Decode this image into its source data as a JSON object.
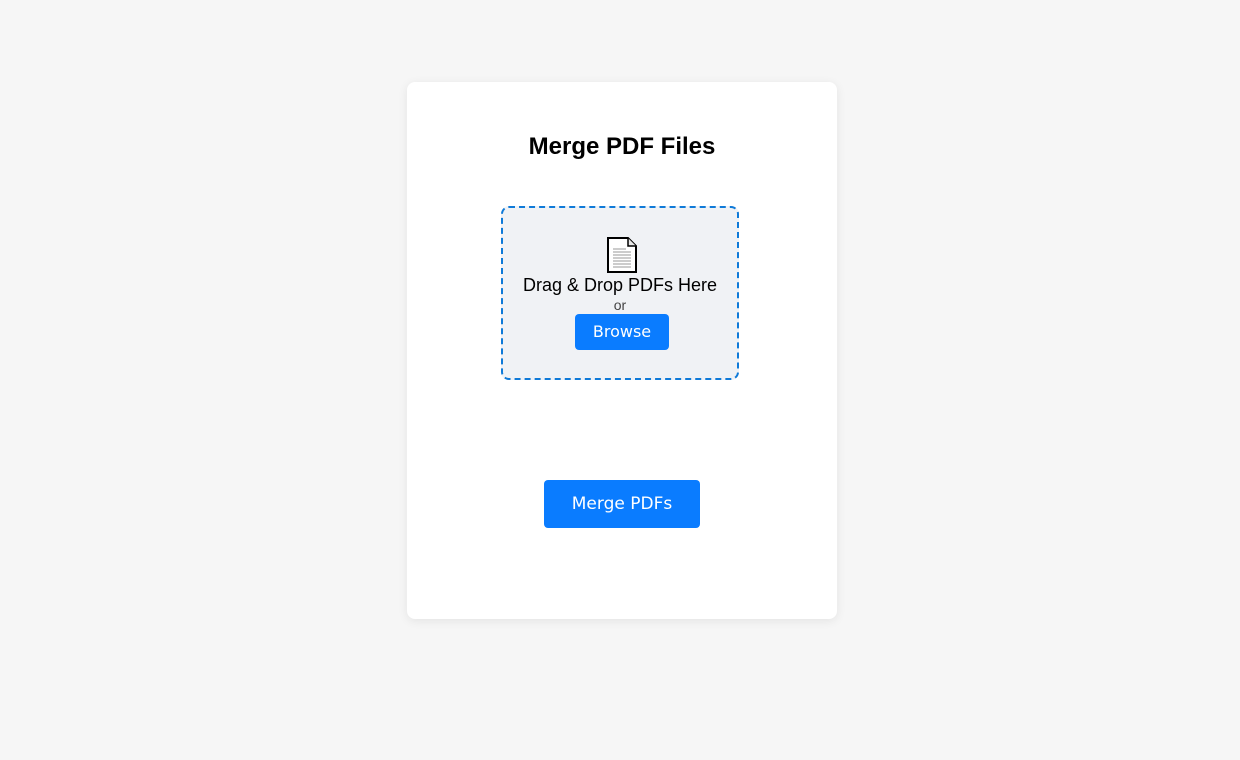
{
  "card": {
    "title": "Merge PDF Files"
  },
  "dropzone": {
    "icon": "document-icon",
    "text": "Drag & Drop PDFs Here",
    "or_text": "or",
    "browse_label": "Browse"
  },
  "actions": {
    "merge_label": "Merge PDFs"
  },
  "colors": {
    "page_background": "#f6f6f6",
    "card_background": "#ffffff",
    "accent": "#0a7cff",
    "dropzone_border": "#0f7ad8",
    "dropzone_background": "#f0f2f5"
  }
}
